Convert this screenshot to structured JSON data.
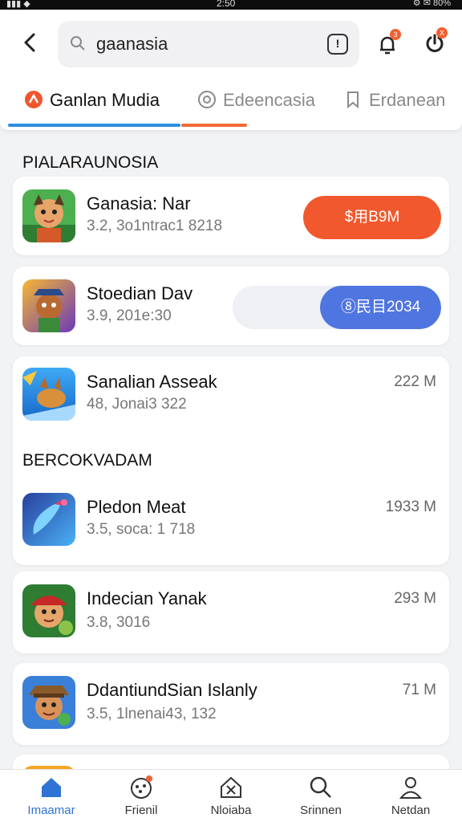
{
  "status_bar": {
    "time": "2:50",
    "left": "▮▮▮ ◆",
    "right": "⚙ ✉ 80%"
  },
  "header": {
    "back_icon": "back-arrow-icon",
    "search": {
      "value": "gaanasia",
      "icon": "search-icon"
    },
    "notification_badge": "3",
    "power_badge": "X"
  },
  "tabs": [
    {
      "label": "Ganlan Mudia",
      "active": true,
      "color": "#f0552c"
    },
    {
      "label": "Edeencasia",
      "active": false
    },
    {
      "label": "Erdanean",
      "active": false
    }
  ],
  "sections": {
    "first_title": "PIALARAUNOSIA",
    "second_title": "BERCOKVADAM"
  },
  "apps": [
    {
      "name": "Ganasia: Nar",
      "meta": "3.2, 3o1ntrac1 8218",
      "action_label": "$用B9M",
      "action_type": "button"
    },
    {
      "name": "Stoedian Dav",
      "meta": "3.9, 201e:30",
      "action_label": "⑧民目2034",
      "action_type": "progress",
      "progress": 0.58
    },
    {
      "name": "Sanalian Asseak",
      "meta": "48, Jonai3 322",
      "size": "222 M"
    },
    {
      "name": "Pledon Meat",
      "meta": "3.5, soca: 1 718",
      "size": "1933 M"
    },
    {
      "name": "Indecian Yanak",
      "meta": "3.8, 3016",
      "size": "293 M"
    },
    {
      "name": "DdantiundSian Islanly",
      "meta": "3.5, 1lnenai43, 132",
      "size": "71 M"
    }
  ],
  "bottom_nav": [
    {
      "label": "Imaamar",
      "icon": "home-icon",
      "active": true
    },
    {
      "label": "Frienil",
      "icon": "game-controller-icon",
      "active": false
    },
    {
      "label": "Nloiaba",
      "icon": "house-x-icon",
      "active": false
    },
    {
      "label": "Srinnen",
      "icon": "search-icon",
      "active": false
    },
    {
      "label": "Netdan",
      "icon": "profile-icon",
      "active": false
    }
  ],
  "colors": {
    "accent_orange": "#f2582d",
    "accent_blue": "#4f75e0",
    "nav_active": "#2f73d6"
  }
}
